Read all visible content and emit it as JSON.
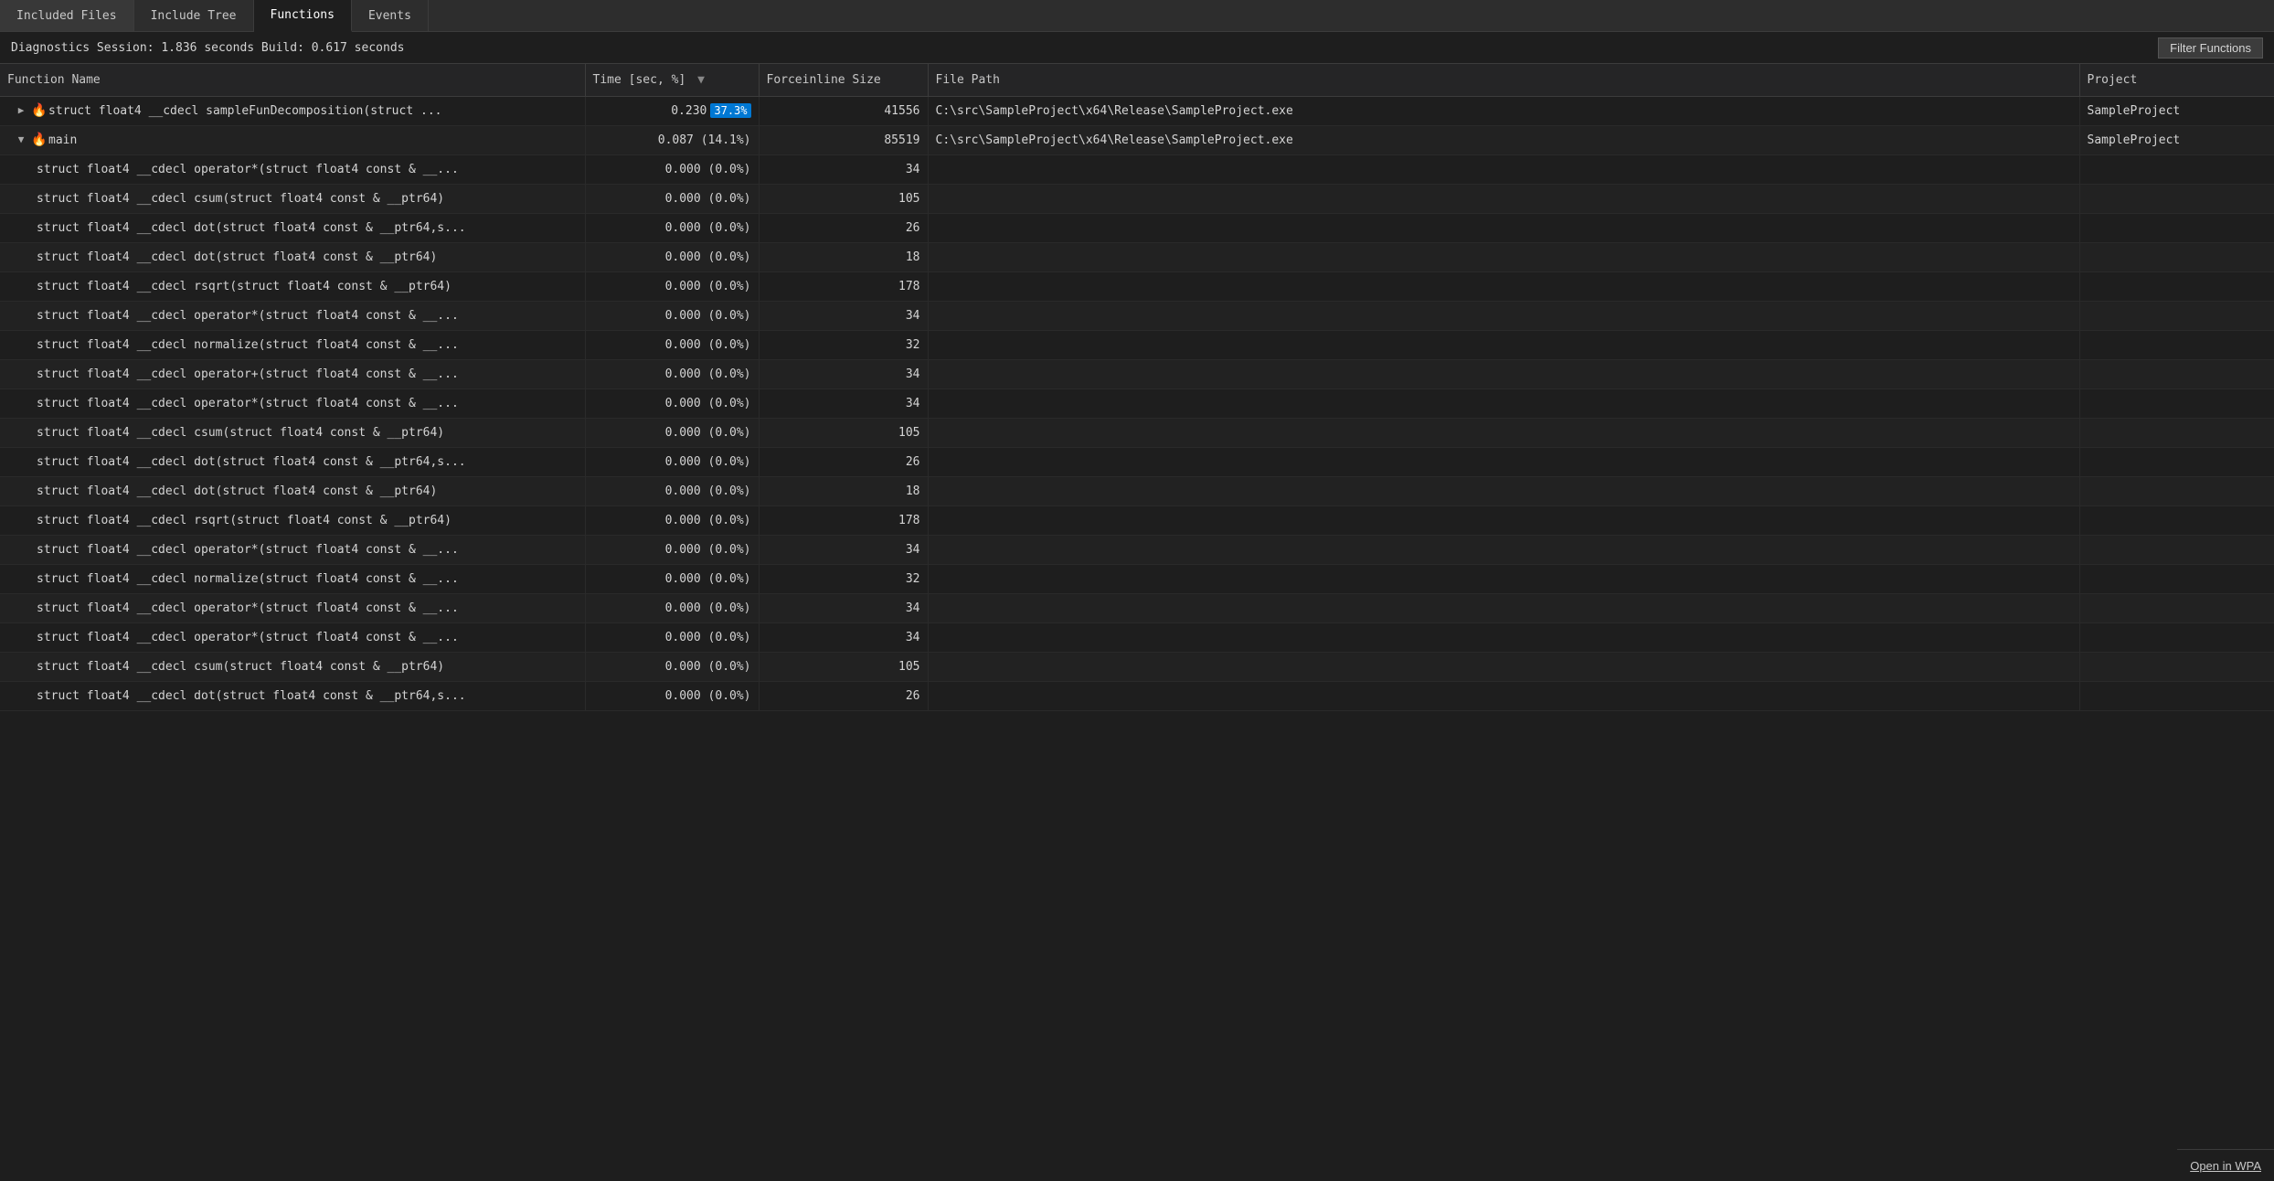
{
  "tabs": [
    {
      "id": "included-files",
      "label": "Included Files",
      "active": false
    },
    {
      "id": "include-tree",
      "label": "Include Tree",
      "active": false
    },
    {
      "id": "functions",
      "label": "Functions",
      "active": true
    },
    {
      "id": "events",
      "label": "Events",
      "active": false
    }
  ],
  "diagnostics": {
    "text": "Diagnostics Session: 1.836 seconds  Build: 0.617 seconds"
  },
  "filter_button_label": "Filter Functions",
  "columns": [
    {
      "id": "name",
      "label": "Function Name",
      "sortable": false
    },
    {
      "id": "time",
      "label": "Time [sec, %]",
      "sortable": true
    },
    {
      "id": "force",
      "label": "Forceinline Size",
      "sortable": false
    },
    {
      "id": "path",
      "label": "File Path",
      "sortable": false
    },
    {
      "id": "project",
      "label": "Project",
      "sortable": false
    }
  ],
  "rows": [
    {
      "indent": 0,
      "expandable": true,
      "expanded": false,
      "has_fire": true,
      "name": "struct float4 __cdecl sampleFunDecomposition(struct ...",
      "time": "0.230",
      "pct": "37.3%",
      "force": "41556",
      "path": "C:\\src\\SampleProject\\x64\\Release\\SampleProject.exe",
      "project": "SampleProject"
    },
    {
      "indent": 0,
      "expandable": true,
      "expanded": true,
      "has_fire": true,
      "name": "main",
      "time": "0.087",
      "pct": "14.1%",
      "force": "85519",
      "path": "C:\\src\\SampleProject\\x64\\Release\\SampleProject.exe",
      "project": "SampleProject"
    },
    {
      "indent": 1,
      "expandable": false,
      "expanded": false,
      "has_fire": false,
      "name": "struct float4 __cdecl operator*(struct float4 const & __...",
      "time": "0.000",
      "pct": "0.0%",
      "force": "34",
      "path": "",
      "project": ""
    },
    {
      "indent": 1,
      "expandable": false,
      "expanded": false,
      "has_fire": false,
      "name": "struct float4 __cdecl csum(struct float4 const & __ptr64)",
      "time": "0.000",
      "pct": "0.0%",
      "force": "105",
      "path": "",
      "project": ""
    },
    {
      "indent": 1,
      "expandable": false,
      "expanded": false,
      "has_fire": false,
      "name": "struct float4 __cdecl dot(struct float4 const & __ptr64,s...",
      "time": "0.000",
      "pct": "0.0%",
      "force": "26",
      "path": "",
      "project": ""
    },
    {
      "indent": 1,
      "expandable": false,
      "expanded": false,
      "has_fire": false,
      "name": "struct float4 __cdecl dot(struct float4 const & __ptr64)",
      "time": "0.000",
      "pct": "0.0%",
      "force": "18",
      "path": "",
      "project": ""
    },
    {
      "indent": 1,
      "expandable": false,
      "expanded": false,
      "has_fire": false,
      "name": "struct float4 __cdecl rsqrt(struct float4 const & __ptr64)",
      "time": "0.000",
      "pct": "0.0%",
      "force": "178",
      "path": "",
      "project": ""
    },
    {
      "indent": 1,
      "expandable": false,
      "expanded": false,
      "has_fire": false,
      "name": "struct float4 __cdecl operator*(struct float4 const & __...",
      "time": "0.000",
      "pct": "0.0%",
      "force": "34",
      "path": "",
      "project": ""
    },
    {
      "indent": 1,
      "expandable": false,
      "expanded": false,
      "has_fire": false,
      "name": "struct float4 __cdecl normalize(struct float4 const & __...",
      "time": "0.000",
      "pct": "0.0%",
      "force": "32",
      "path": "",
      "project": ""
    },
    {
      "indent": 1,
      "expandable": false,
      "expanded": false,
      "has_fire": false,
      "name": "struct float4 __cdecl operator+(struct float4 const & __...",
      "time": "0.000",
      "pct": "0.0%",
      "force": "34",
      "path": "",
      "project": ""
    },
    {
      "indent": 1,
      "expandable": false,
      "expanded": false,
      "has_fire": false,
      "name": "struct float4 __cdecl operator*(struct float4 const & __...",
      "time": "0.000",
      "pct": "0.0%",
      "force": "34",
      "path": "",
      "project": ""
    },
    {
      "indent": 1,
      "expandable": false,
      "expanded": false,
      "has_fire": false,
      "name": "struct float4 __cdecl csum(struct float4 const & __ptr64)",
      "time": "0.000",
      "pct": "0.0%",
      "force": "105",
      "path": "",
      "project": ""
    },
    {
      "indent": 1,
      "expandable": false,
      "expanded": false,
      "has_fire": false,
      "name": "struct float4 __cdecl dot(struct float4 const & __ptr64,s...",
      "time": "0.000",
      "pct": "0.0%",
      "force": "26",
      "path": "",
      "project": ""
    },
    {
      "indent": 1,
      "expandable": false,
      "expanded": false,
      "has_fire": false,
      "name": "struct float4 __cdecl dot(struct float4 const & __ptr64)",
      "time": "0.000",
      "pct": "0.0%",
      "force": "18",
      "path": "",
      "project": ""
    },
    {
      "indent": 1,
      "expandable": false,
      "expanded": false,
      "has_fire": false,
      "name": "struct float4 __cdecl rsqrt(struct float4 const & __ptr64)",
      "time": "0.000",
      "pct": "0.0%",
      "force": "178",
      "path": "",
      "project": ""
    },
    {
      "indent": 1,
      "expandable": false,
      "expanded": false,
      "has_fire": false,
      "name": "struct float4 __cdecl operator*(struct float4 const & __...",
      "time": "0.000",
      "pct": "0.0%",
      "force": "34",
      "path": "",
      "project": ""
    },
    {
      "indent": 1,
      "expandable": false,
      "expanded": false,
      "has_fire": false,
      "name": "struct float4 __cdecl normalize(struct float4 const & __...",
      "time": "0.000",
      "pct": "0.0%",
      "force": "32",
      "path": "",
      "project": ""
    },
    {
      "indent": 1,
      "expandable": false,
      "expanded": false,
      "has_fire": false,
      "name": "struct float4 __cdecl operator*(struct float4 const & __...",
      "time": "0.000",
      "pct": "0.0%",
      "force": "34",
      "path": "",
      "project": ""
    },
    {
      "indent": 1,
      "expandable": false,
      "expanded": false,
      "has_fire": false,
      "name": "struct float4 __cdecl operator*(struct float4 const & __...",
      "time": "0.000",
      "pct": "0.0%",
      "force": "34",
      "path": "",
      "project": ""
    },
    {
      "indent": 1,
      "expandable": false,
      "expanded": false,
      "has_fire": false,
      "name": "struct float4 __cdecl csum(struct float4 const & __ptr64)",
      "time": "0.000",
      "pct": "0.0%",
      "force": "105",
      "path": "",
      "project": ""
    },
    {
      "indent": 1,
      "expandable": false,
      "expanded": false,
      "has_fire": false,
      "name": "struct float4 __cdecl dot(struct float4 const & __ptr64,s...",
      "time": "0.000",
      "pct": "0.0%",
      "force": "26",
      "path": "",
      "project": ""
    }
  ],
  "bottom_bar": {
    "open_wpa_label": "Open in WPA"
  },
  "colors": {
    "active_tab_bg": "#1e1e1e",
    "inactive_tab_bg": "#2d2d2d",
    "header_bg": "#252526",
    "row_even": "#222222",
    "row_odd": "#1e1e1e",
    "highlight_blue": "#0078d4",
    "fire_color": "#e05a00"
  }
}
